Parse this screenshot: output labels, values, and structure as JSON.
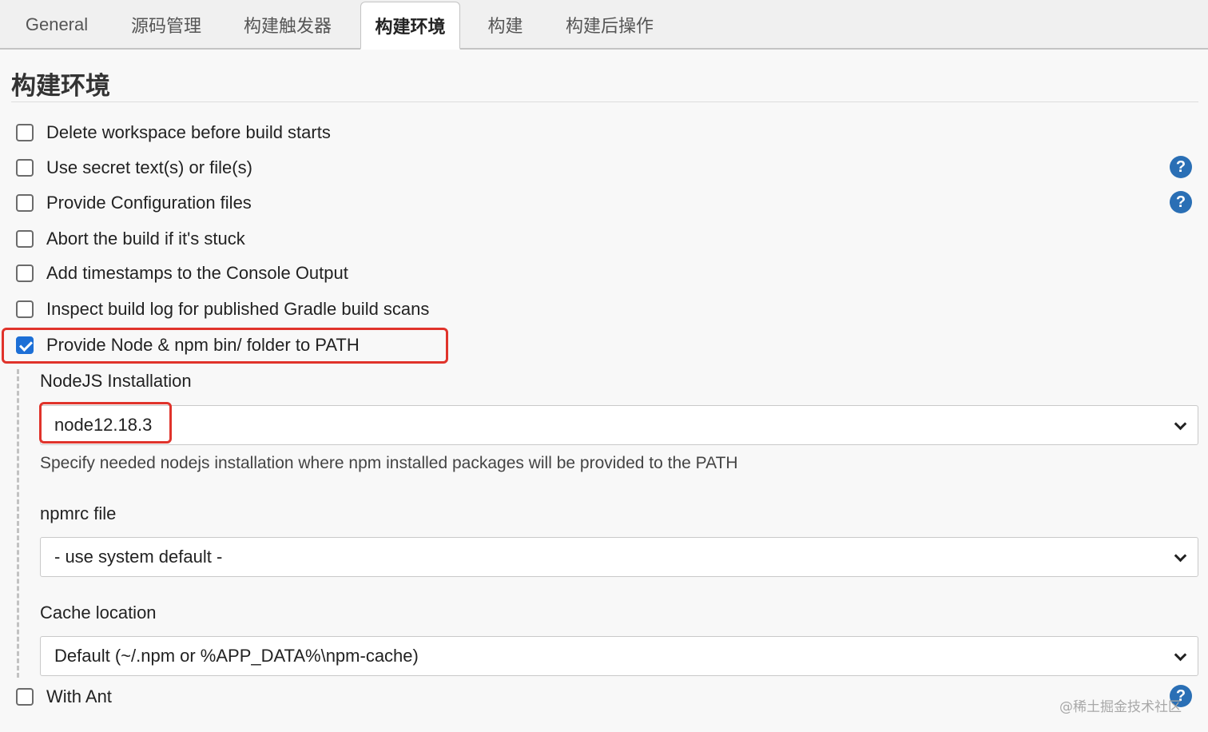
{
  "tabs": [
    {
      "label": "General",
      "active": false
    },
    {
      "label": "源码管理",
      "active": false
    },
    {
      "label": "构建触发器",
      "active": false
    },
    {
      "label": "构建环境",
      "active": true
    },
    {
      "label": "构建",
      "active": false
    },
    {
      "label": "构建后操作",
      "active": false
    }
  ],
  "section": {
    "title": "构建环境"
  },
  "options": [
    {
      "label": "Delete workspace before build starts",
      "checked": false
    },
    {
      "label": "Use secret text(s) or file(s)",
      "checked": false,
      "help": true
    },
    {
      "label": "Provide Configuration files",
      "checked": false,
      "help": true
    },
    {
      "label": "Abort the build if it's stuck",
      "checked": false
    },
    {
      "label": "Add timestamps to the Console Output",
      "checked": false
    },
    {
      "label": "Inspect build log for published Gradle build scans",
      "checked": false
    },
    {
      "label": "Provide Node & npm bin/ folder to PATH",
      "checked": true
    },
    {
      "label": "With Ant",
      "checked": false,
      "help": true
    }
  ],
  "nodejs": {
    "installation_label": "NodeJS Installation",
    "installation_value": "node12.18.3",
    "installation_help": "Specify needed nodejs installation where npm installed packages will be provided to the PATH",
    "npmrc_label": "npmrc file",
    "npmrc_value": "- use system default -",
    "cache_label": "Cache location",
    "cache_value": "Default (~/.npm or %APP_DATA%\\npm-cache)"
  },
  "help_icon_glyph": "?",
  "colors": {
    "highlight": "#e0332b",
    "checkbox_checked": "#1d6fd6",
    "help_icon": "#2a6fb5"
  },
  "watermark": "@稀土掘金技术社区"
}
